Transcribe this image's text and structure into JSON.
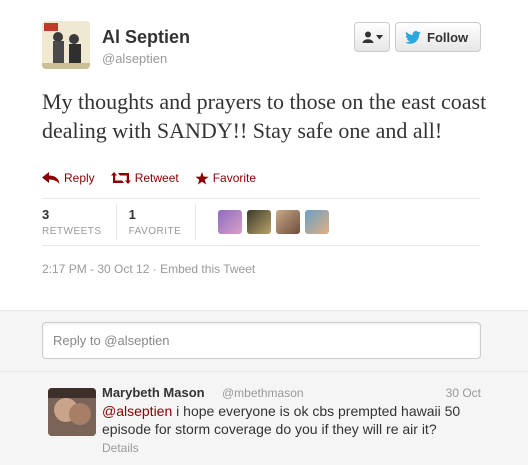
{
  "user": {
    "fullname": "Al Septien",
    "username": "@alseptien"
  },
  "follow_button": {
    "label": "Follow"
  },
  "tweet": {
    "text": "My thoughts and prayers to those on the east coast dealing with SANDY!! Stay safe one and all!"
  },
  "actions": {
    "reply": "Reply",
    "retweet": "Retweet",
    "favorite": "Favorite"
  },
  "stats": {
    "retweets_count": "3",
    "retweets_label": "RETWEETS",
    "favorites_count": "1",
    "favorites_label": "FAVORITE"
  },
  "meta": {
    "timestamp": "2:17 PM - 30 Oct 12",
    "separator": "·",
    "embed": "Embed this Tweet"
  },
  "reply_box": {
    "placeholder": "Reply to @alseptien"
  },
  "reply_tweet": {
    "name": "Marybeth Mason",
    "handle": "@mbethmason",
    "time": "30 Oct",
    "mention": "@alseptien",
    "text": " i hope everyone is ok cbs prempted hawaii 50 episode for storm coverage do you if they will re air it?",
    "details": "Details"
  },
  "colors": {
    "action_red": "#8b0000",
    "twitter_blue": "#2aa9e0",
    "muted_gray": "#999999"
  }
}
